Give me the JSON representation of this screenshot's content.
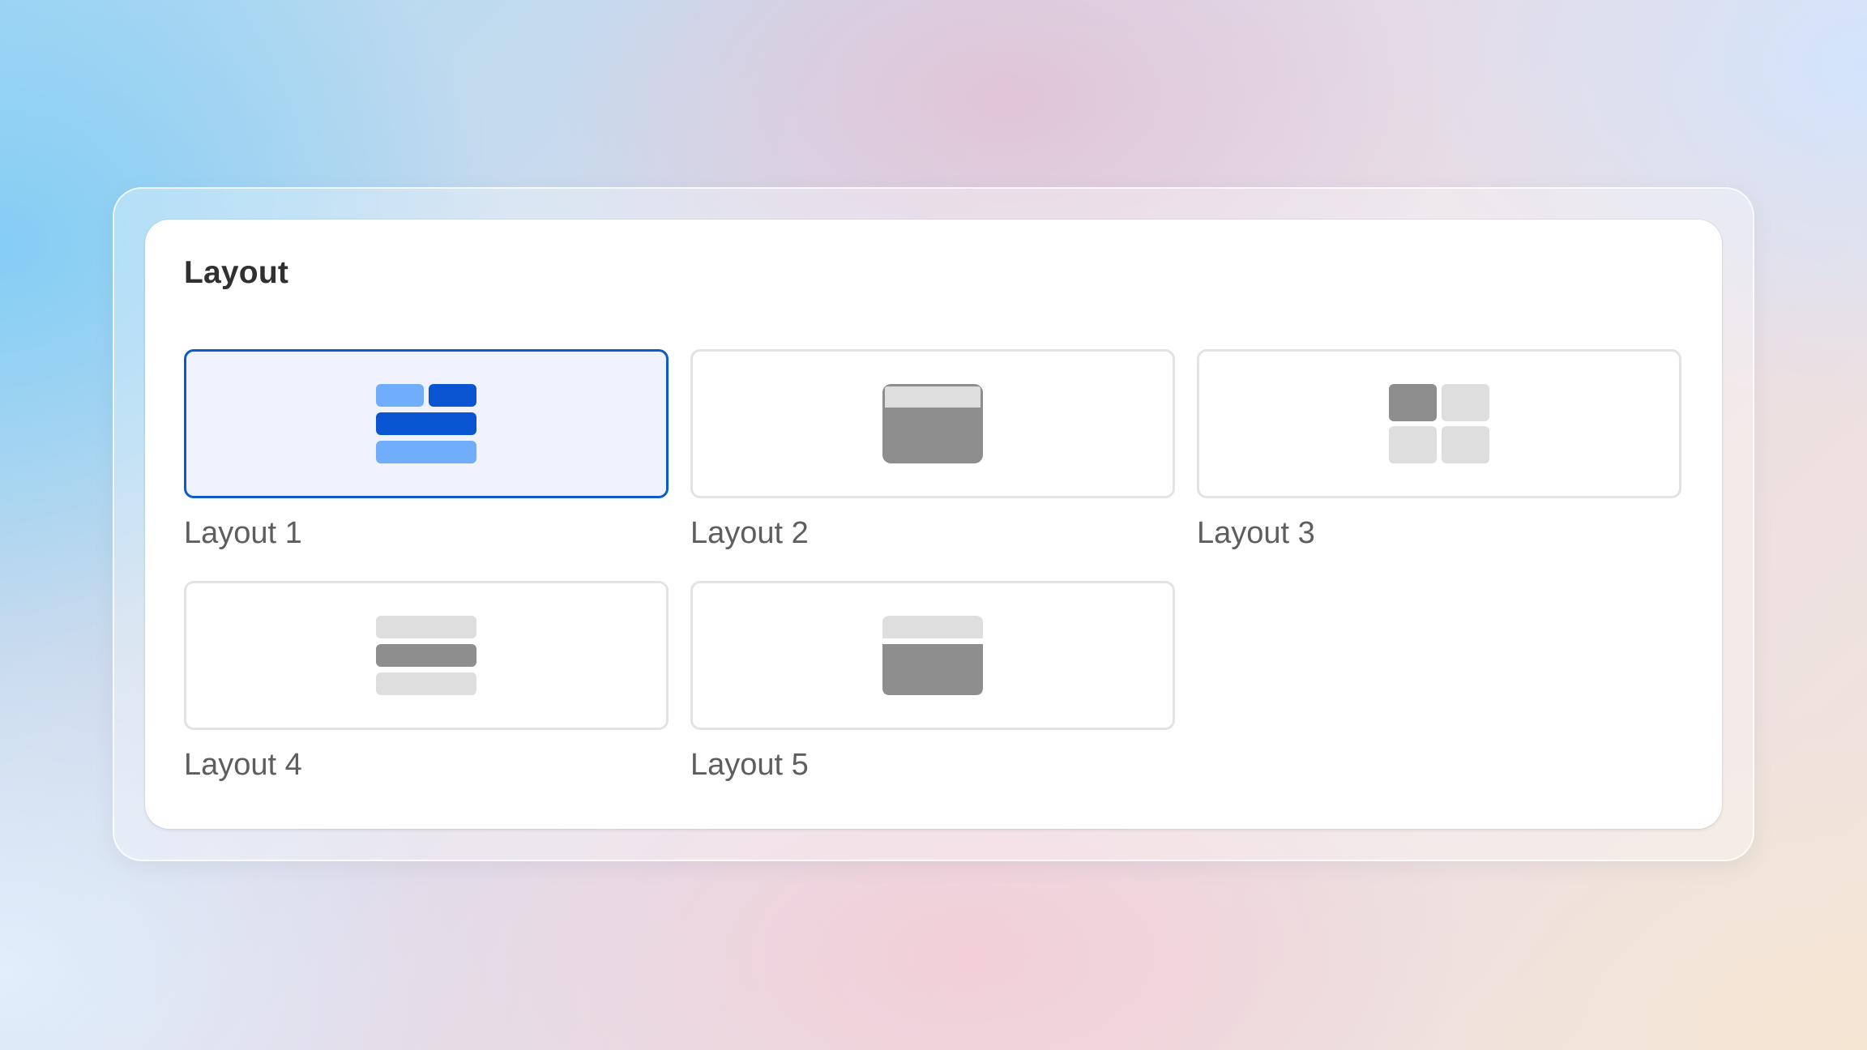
{
  "panel": {
    "title": "Layout"
  },
  "layouts": [
    {
      "label": "Layout 1",
      "selected": true,
      "icon": "layout-rows-split-icon"
    },
    {
      "label": "Layout 2",
      "selected": false,
      "icon": "layout-header-window-icon"
    },
    {
      "label": "Layout 3",
      "selected": false,
      "icon": "layout-grid-2x2-icon"
    },
    {
      "label": "Layout 4",
      "selected": false,
      "icon": "layout-three-rows-icon"
    },
    {
      "label": "Layout 5",
      "selected": false,
      "icon": "layout-header-body-icon"
    }
  ],
  "colors": {
    "selected_border": "#0b5bcf",
    "selected_fill": "#f0f3fd",
    "icon_blue_dark": "#0a55d1",
    "icon_blue_light": "#70aefb",
    "icon_gray_dark": "#8e8e8e",
    "icon_gray_light": "#dedede"
  }
}
